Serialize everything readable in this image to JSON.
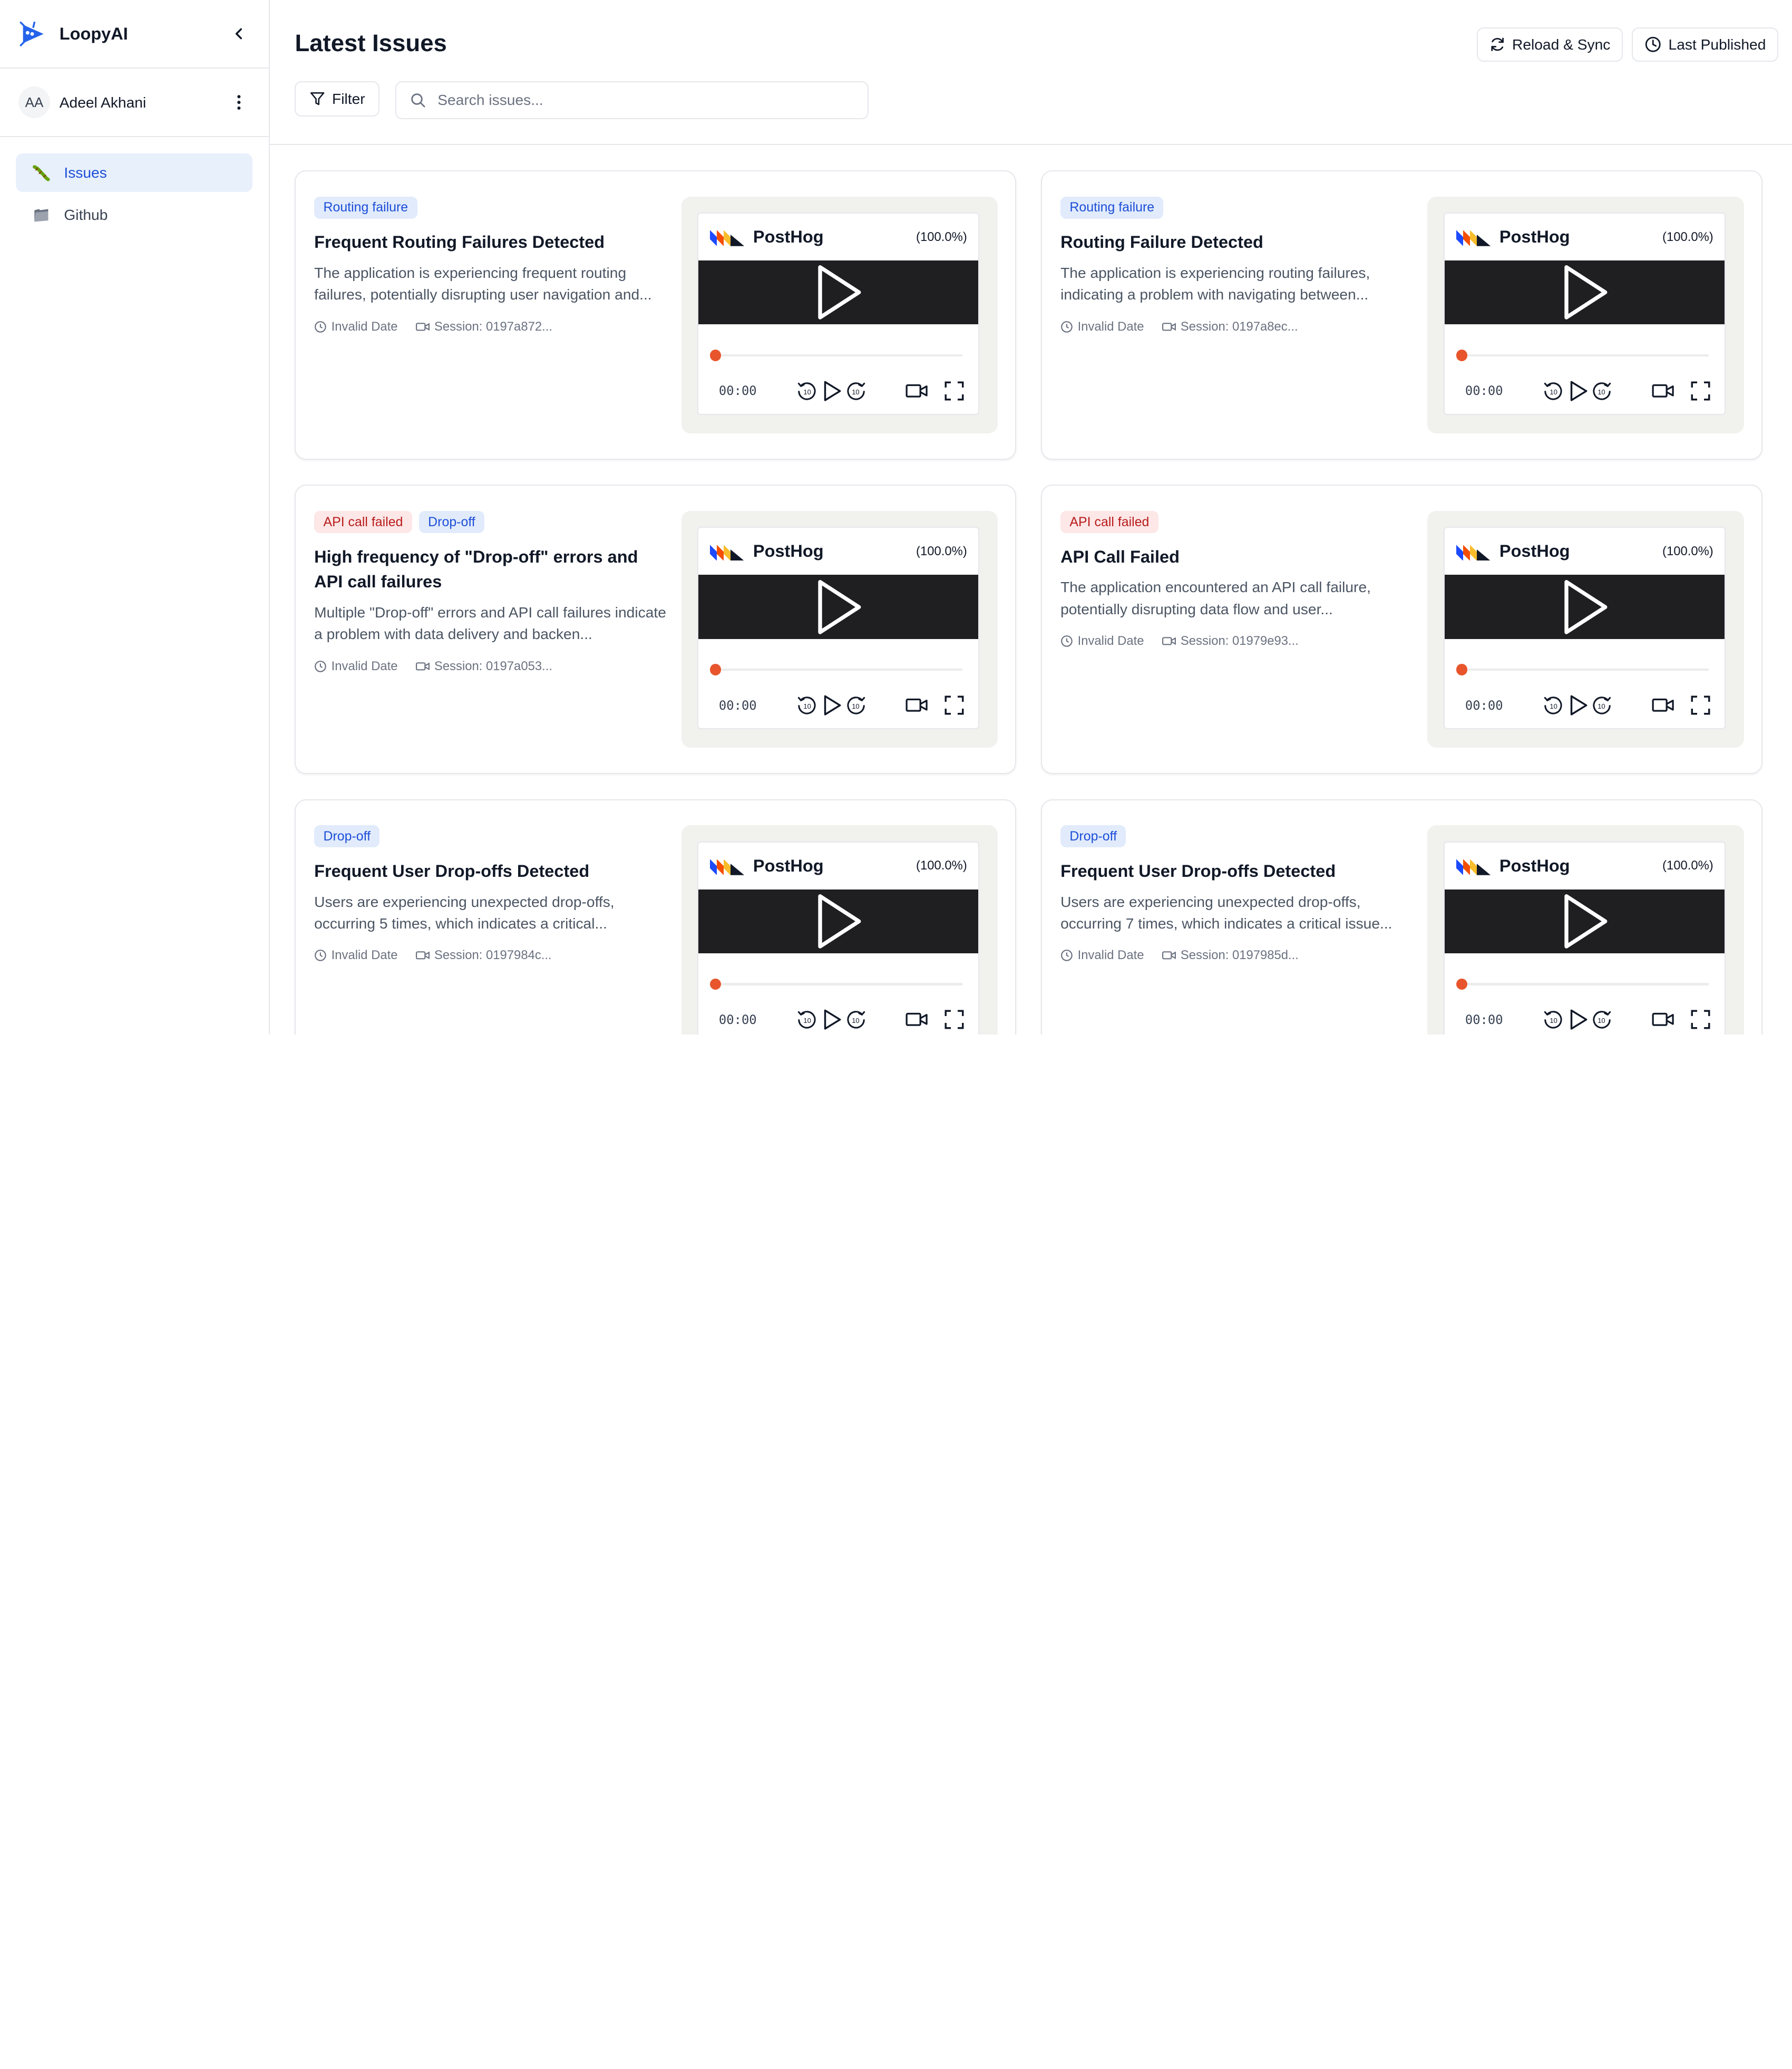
{
  "app": {
    "name": "LoopyAI"
  },
  "user": {
    "initials": "AA",
    "name": "Adeel Akhani"
  },
  "sidebar": {
    "items": [
      {
        "label": "Issues",
        "icon": "bug-icon",
        "active": true
      },
      {
        "label": "Github",
        "icon": "folder-icon",
        "active": false
      }
    ]
  },
  "header": {
    "title": "Latest Issues",
    "reload_label": "Reload & Sync",
    "published_label": "Last Published",
    "filter_label": "Filter",
    "search_placeholder": "Search issues..."
  },
  "player": {
    "brand": "PostHog",
    "time": "00:00",
    "colors": {
      "progress": "#e8552c",
      "screen": "#1f1f21"
    }
  },
  "colors": {
    "accent": "#1d4ed8",
    "tag_blue_bg": "#e1ebfb",
    "tag_red_bg": "#fde7e7"
  },
  "issues": [
    {
      "tags": [
        {
          "label": "Routing failure",
          "kind": "blue"
        }
      ],
      "title": "Frequent Routing Failures Detected",
      "description": "The application is experiencing frequent routing failures, potentially disrupting user navigation and...",
      "date": "Invalid Date",
      "session": "Session: 0197a872...",
      "progress": "(100.0%)"
    },
    {
      "tags": [
        {
          "label": "Routing failure",
          "kind": "blue"
        }
      ],
      "title": "Routing Failure Detected",
      "description": "The application is experiencing routing failures, indicating a problem with navigating between...",
      "date": "Invalid Date",
      "session": "Session: 0197a8ec...",
      "progress": "(100.0%)"
    },
    {
      "tags": [
        {
          "label": "API call failed",
          "kind": "red"
        },
        {
          "label": "Drop-off",
          "kind": "blue"
        }
      ],
      "title": "High frequency of \"Drop-off\" errors and API call failures",
      "description": "Multiple \"Drop-off\" errors and API call failures indicate a problem with data delivery and backen...",
      "date": "Invalid Date",
      "session": "Session: 0197a053...",
      "progress": "(100.0%)"
    },
    {
      "tags": [
        {
          "label": "API call failed",
          "kind": "red"
        }
      ],
      "title": "API Call Failed",
      "description": "The application encountered an API call failure, potentially disrupting data flow and user...",
      "date": "Invalid Date",
      "session": "Session: 01979e93...",
      "progress": "(100.0%)"
    },
    {
      "tags": [
        {
          "label": "Drop-off",
          "kind": "blue"
        }
      ],
      "title": "Frequent User Drop-offs Detected",
      "description": "Users are experiencing unexpected drop-offs, occurring 5 times, which indicates a critical...",
      "date": "Invalid Date",
      "session": "Session: 0197984c...",
      "progress": "(100.0%)"
    },
    {
      "tags": [
        {
          "label": "Drop-off",
          "kind": "blue"
        }
      ],
      "title": "Frequent User Drop-offs Detected",
      "description": "Users are experiencing unexpected drop-offs, occurring 7 times, which indicates a critical issue...",
      "date": "Invalid Date",
      "session": "Session: 0197985d...",
      "progress": "(100.0%)"
    }
  ]
}
